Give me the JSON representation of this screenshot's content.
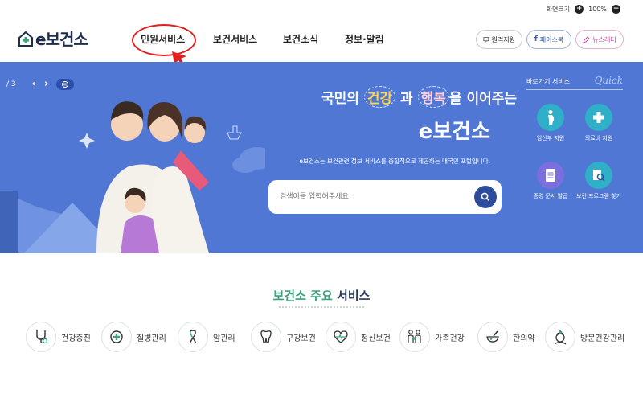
{
  "util": {
    "text_size_label": "화면크기",
    "plus_label": "+",
    "zoom": "100%",
    "minus_label": "−"
  },
  "header": {
    "logo": "e보건소",
    "nav": [
      "민원서비스",
      "보건서비스",
      "보건소식",
      "정보·알림"
    ],
    "buttons": [
      "원격지원",
      "페이스북",
      "뉴스레터"
    ]
  },
  "hero": {
    "slide_counter": "/ 3",
    "title_pre": "국민의",
    "title_h1": "건강",
    "title_mid": "과",
    "title_h2": "행복",
    "title_post": "을 이어주는",
    "brand": "e보건소",
    "description": "e보건소는 보건관련 정보 서비스를 종합적으로 제공하는 대국민 포털입니다.",
    "search_placeholder": "검색어를 입력해주세요"
  },
  "quick": {
    "title": "바로가기 서비스",
    "title_en": "Quick",
    "items": [
      "임산부 지원",
      "의료비 지원",
      "증명 문서 발급",
      "보건 프로그램 찾기"
    ]
  },
  "services": {
    "title_green": "보건소 주요",
    "title_dark": "서비스",
    "items": [
      "건강증진",
      "질병관리",
      "암관리",
      "구강보건",
      "정신보건",
      "가족건강",
      "한의약",
      "방문건강관리"
    ]
  },
  "colors": {
    "hero_bg": "#4f77d3",
    "accent_green": "#3aa37a",
    "quick_teal": "#2fb0c8",
    "quick_purple": "#7b6fe0",
    "annotation_red": "#e02020"
  }
}
